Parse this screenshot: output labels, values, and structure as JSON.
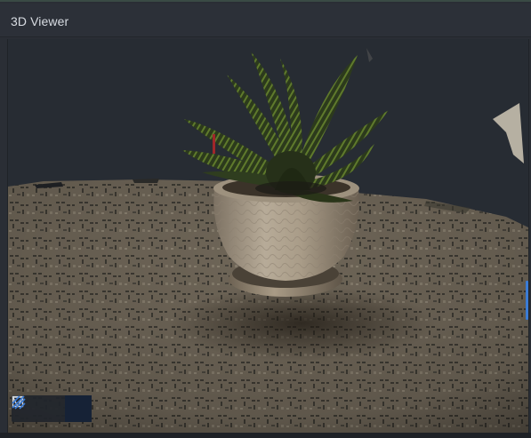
{
  "window": {
    "title": "3D Viewer"
  },
  "toolbar": {
    "buttons": [
      {
        "icon": "square-icon",
        "active": false
      },
      {
        "icon": "triangle-down-icon",
        "active": false
      },
      {
        "icon": "hatch-pattern-icon",
        "active": true
      }
    ]
  },
  "colors": {
    "accent": "#3a7bd5",
    "background": "#272c33",
    "titlebar": "#2c3038"
  }
}
